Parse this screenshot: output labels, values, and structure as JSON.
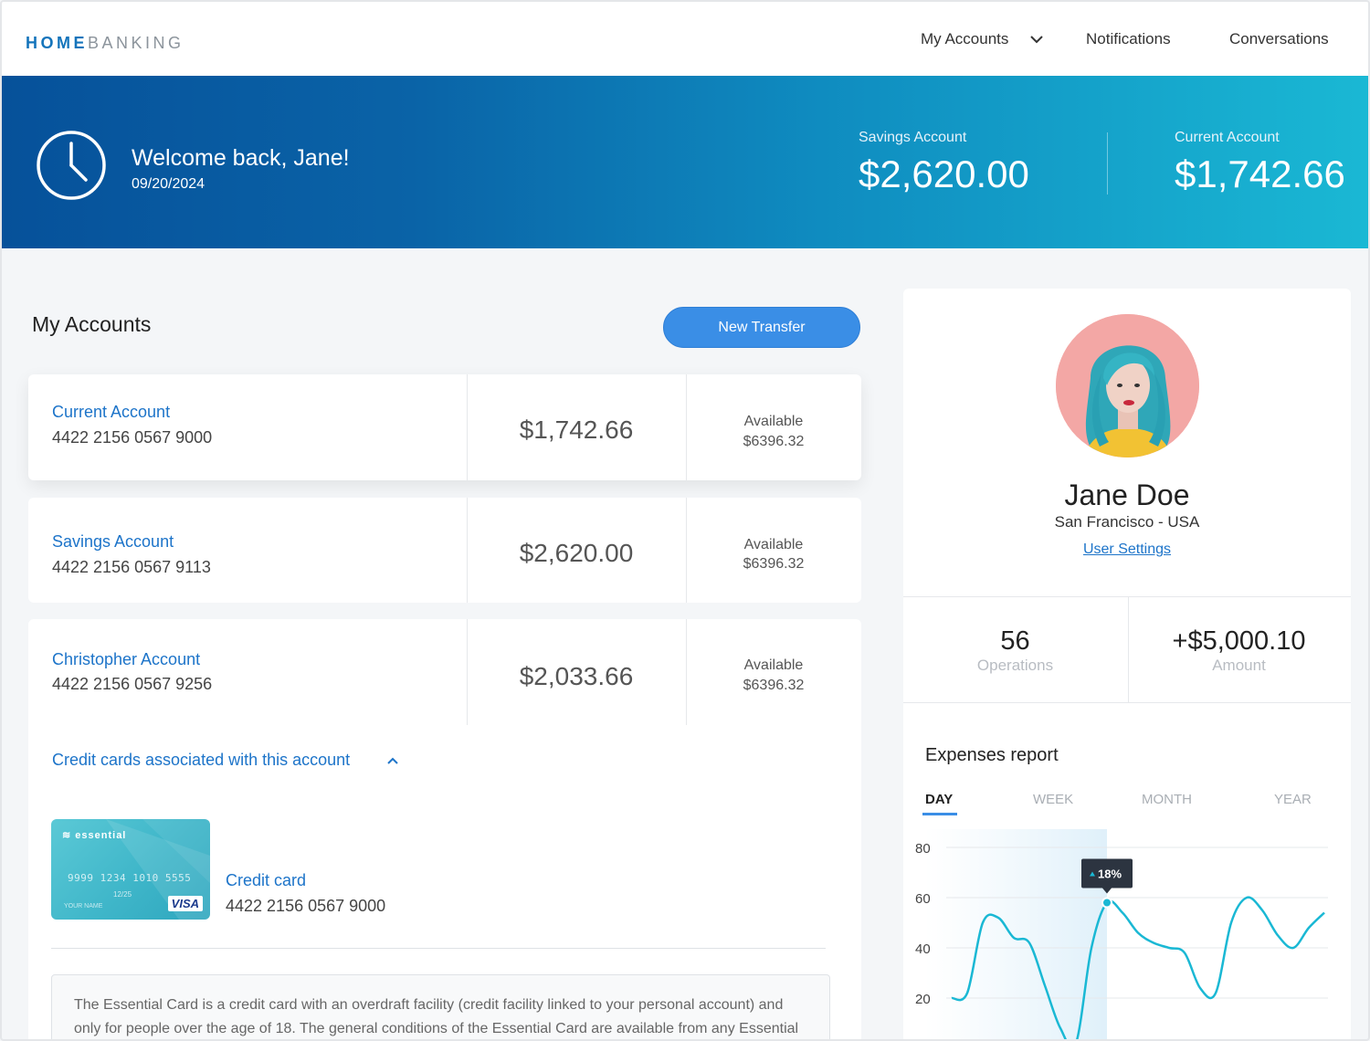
{
  "header": {
    "logo_home": "HOME",
    "logo_banking": "BANKING",
    "nav": {
      "my_accounts": "My Accounts",
      "notifications": "Notifications",
      "conversations": "Conversations"
    }
  },
  "hero": {
    "welcome": "Welcome back, Jane!",
    "date": "09/20/2024",
    "savings_label": "Savings Account",
    "savings_value": "$2,620.00",
    "current_label": "Current Account",
    "current_value": "$1,742.66"
  },
  "accounts_section": {
    "title": "My Accounts",
    "new_transfer": "New Transfer",
    "accounts": [
      {
        "name": "Current Account",
        "number": "4422 2156 0567 9000",
        "balance": "$1,742.66",
        "available_label": "Available",
        "available_value": "$6396.32"
      },
      {
        "name": "Savings Account",
        "number": "4422 2156 0567 9113",
        "balance": "$2,620.00",
        "available_label": "Available",
        "available_value": "$6396.32"
      },
      {
        "name": "Christopher Account",
        "number": "4422 2156 0567 9256",
        "balance": "$2,033.66",
        "available_label": "Available",
        "available_value": "$6396.32"
      }
    ],
    "credit_cards_toggle": "Credit cards associated with this account",
    "credit_card": {
      "card_brand": "essential",
      "card_number_print": "9999 1234 1010 5555",
      "card_expiry": "12/25",
      "card_holder": "YOUR NAME",
      "card_network": "VISA",
      "title": "Credit card",
      "number": "4422 2156 0567 9000"
    },
    "info_text": "The Essential Card is a credit card with an overdraft facility (credit facility linked to your personal account) and only for people over the age of 18. The general conditions of the Essential Card are available from any Essential"
  },
  "profile": {
    "name": "Jane Doe",
    "location": "San Francisco - USA",
    "settings_link": "User Settings",
    "operations_value": "56",
    "operations_label": "Operations",
    "amount_value": "+$5,000.10",
    "amount_label": "Amount"
  },
  "expenses": {
    "title": "Expenses report",
    "tabs": [
      "DAY",
      "WEEK",
      "MONTH",
      "YEAR"
    ],
    "active_tab": "DAY",
    "tooltip": "18%",
    "accent_color": "#1ab8d4"
  },
  "chart_data": {
    "type": "line",
    "title": "Expenses report",
    "ylim": [
      0,
      80
    ],
    "yticks": [
      20,
      40,
      60,
      80
    ],
    "x": [
      0,
      1,
      2,
      3,
      4,
      5,
      6,
      7,
      8,
      9,
      10,
      11,
      12,
      13,
      14,
      15,
      16,
      17,
      18,
      19,
      20,
      21,
      22,
      23,
      24
    ],
    "series": [
      {
        "values": [
          20,
          22,
          50,
          52,
          44,
          42,
          25,
          8,
          2,
          40,
          58,
          54,
          46,
          42,
          40,
          38,
          24,
          22,
          50,
          60,
          55,
          45,
          40,
          48,
          54
        ]
      }
    ],
    "highlight_index": 10,
    "highlight_label": "18%"
  }
}
